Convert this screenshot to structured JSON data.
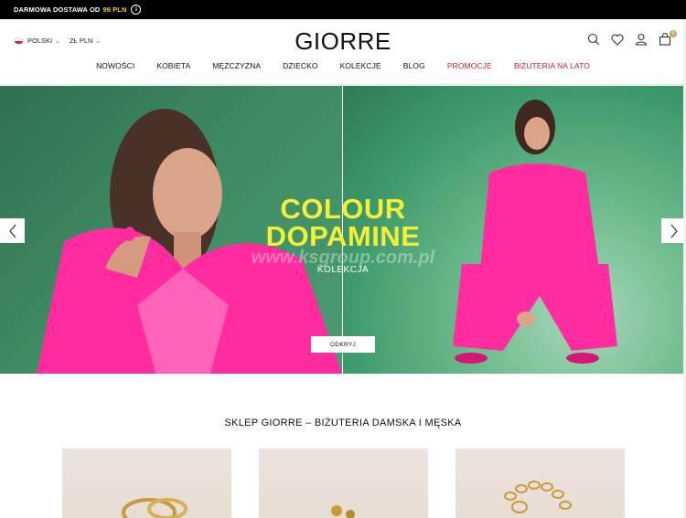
{
  "topbar": {
    "text": "DARMOWA DOSTAWA OD",
    "amount": "99 PLN",
    "info_glyph": "i"
  },
  "header": {
    "language": "POLSKI",
    "currency": "ZŁ PLN",
    "logo": "GIORRE",
    "cart_count": "0",
    "icons": [
      "search-icon",
      "heart-icon",
      "user-icon",
      "cart-icon"
    ]
  },
  "nav": {
    "items": [
      "NOWOŚCI",
      "KOBIETA",
      "MĘŻCZYZNA",
      "DZIECKO",
      "KOLEKCJE",
      "BLOG",
      "PROMOCJE",
      "BIŻUTERIA NA LATO"
    ],
    "accent_color": "#c41e2a"
  },
  "hero": {
    "title_line1": "COLOUR",
    "title_line2": "DOPAMINE",
    "subtitle": "KOLEKCJA",
    "watermark": "www.ksgroup.com.pl",
    "button": "ODKRYJ",
    "title_color": "#f4f03a",
    "background_color": "#3e8a62",
    "outfit_color": "#ff2da0"
  },
  "section": {
    "title": "SKLEP GIORRE – BIŻUTERIA DAMSKA I MĘSKA"
  }
}
